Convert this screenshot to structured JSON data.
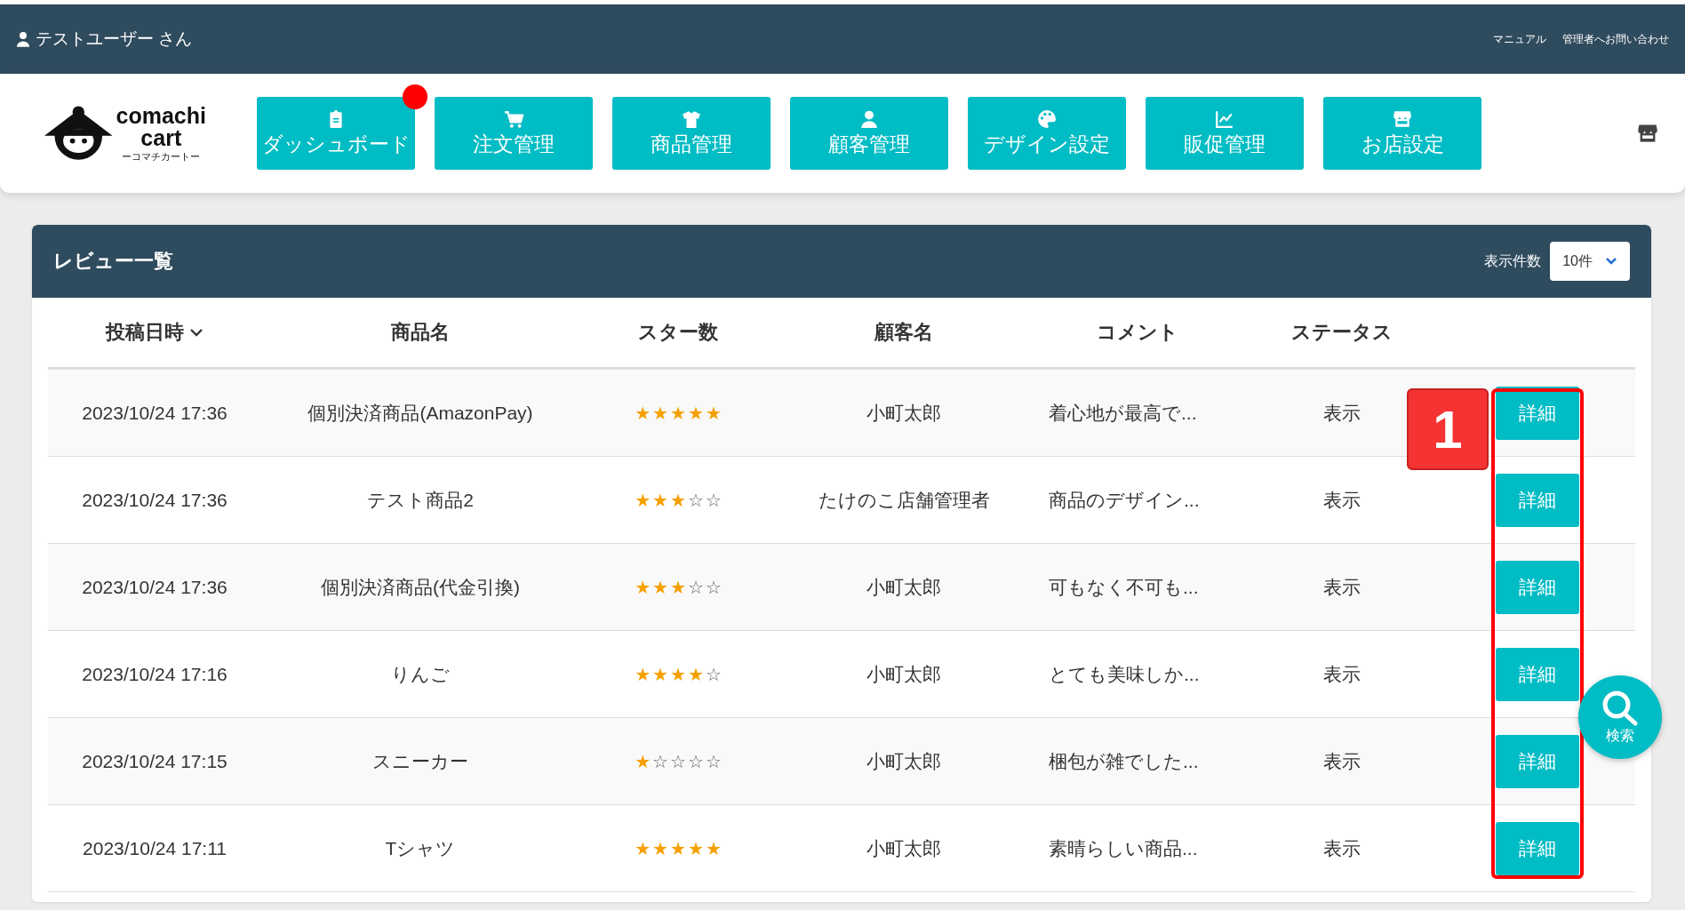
{
  "top_bar": {
    "user": "テストユーザー さん",
    "links": [
      "マニュアル",
      "管理者へお問い合わせ"
    ]
  },
  "logo": {
    "name_line1": "comachi",
    "name_line2": "cart",
    "reading": "ーコマチカートー"
  },
  "nav": [
    {
      "label": "ダッシュボード",
      "notification": true
    },
    {
      "label": "注文管理",
      "notification": false
    },
    {
      "label": "商品管理",
      "notification": false
    },
    {
      "label": "顧客管理",
      "notification": false
    },
    {
      "label": "デザイン設定",
      "notification": false
    },
    {
      "label": "販促管理",
      "notification": false
    },
    {
      "label": "お店設定",
      "notification": false
    }
  ],
  "panel": {
    "title": "レビュー一覧",
    "per_page_label": "表示件数",
    "per_page_value": "10件"
  },
  "table": {
    "columns": [
      {
        "label": "投稿日時",
        "sorted": true
      },
      {
        "label": "商品名",
        "sorted": false
      },
      {
        "label": "スター数",
        "sorted": false
      },
      {
        "label": "顧客名",
        "sorted": false
      },
      {
        "label": "コメント",
        "sorted": false
      },
      {
        "label": "ステータス",
        "sorted": false
      }
    ],
    "rows": [
      {
        "date": "2023/10/24 17:36",
        "product": "個別決済商品(AmazonPay)",
        "stars": 5,
        "customer": "小町太郎",
        "comment": "着心地が最高で...",
        "status": "表示",
        "action": "詳細"
      },
      {
        "date": "2023/10/24 17:36",
        "product": "テスト商品2",
        "stars": 3,
        "customer": "たけのこ店舗管理者",
        "comment": "商品のデザイン...",
        "status": "表示",
        "action": "詳細"
      },
      {
        "date": "2023/10/24 17:36",
        "product": "個別決済商品(代金引換)",
        "stars": 3,
        "customer": "小町太郎",
        "comment": "可もなく不可も...",
        "status": "表示",
        "action": "詳細"
      },
      {
        "date": "2023/10/24 17:16",
        "product": "りんご",
        "stars": 4,
        "customer": "小町太郎",
        "comment": "とても美味しか...",
        "status": "表示",
        "action": "詳細"
      },
      {
        "date": "2023/10/24 17:15",
        "product": "スニーカー",
        "stars": 1,
        "customer": "小町太郎",
        "comment": "梱包が雑でした...",
        "status": "表示",
        "action": "詳細"
      },
      {
        "date": "2023/10/24 17:11",
        "product": "Tシャツ",
        "stars": 5,
        "customer": "小町太郎",
        "comment": "素晴らしい商品...",
        "status": "表示",
        "action": "詳細"
      }
    ]
  },
  "annotation": {
    "label": "1"
  },
  "search_button": {
    "label": "検索"
  }
}
